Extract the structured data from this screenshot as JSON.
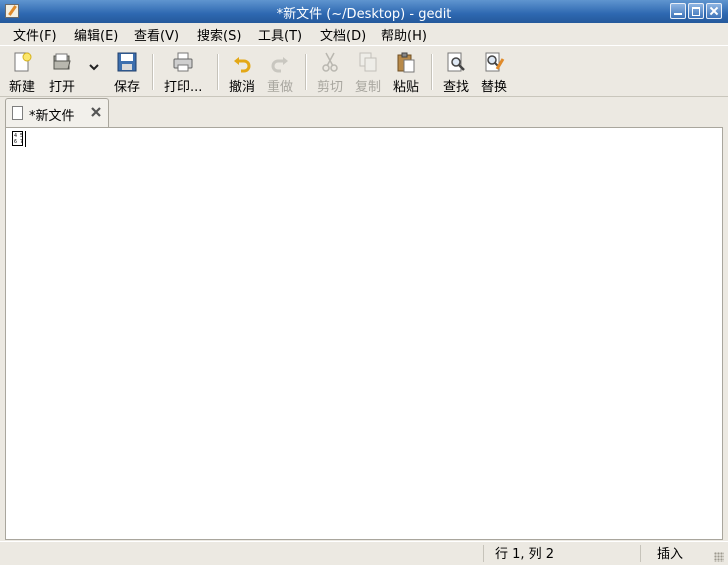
{
  "window": {
    "title": "*新文件 (~/Desktop) - gedit"
  },
  "menubar": {
    "items": [
      "文件(F)",
      "编辑(E)",
      "查看(V)",
      "搜索(S)",
      "工具(T)",
      "文档(D)",
      "帮助(H)"
    ]
  },
  "toolbar": {
    "new": "新建",
    "open": "打开",
    "save": "保存",
    "print": "打印...",
    "undo": "撤消",
    "redo": "重做",
    "cut": "剪切",
    "copy": "复制",
    "paste": "粘贴",
    "find": "查找",
    "replace": "替换",
    "disabled": [
      "redo",
      "cut",
      "copy"
    ]
  },
  "tabs": [
    {
      "label": "*新文件"
    }
  ],
  "editor": {
    "glyph_box_text": "4 5\n6 7"
  },
  "statusbar": {
    "position": "行 1, 列 2",
    "mode": "插入"
  },
  "colors": {
    "titlebar": "#2e68b1",
    "disabled_text": "#a8a69f",
    "chrome": "#ece9e2"
  }
}
